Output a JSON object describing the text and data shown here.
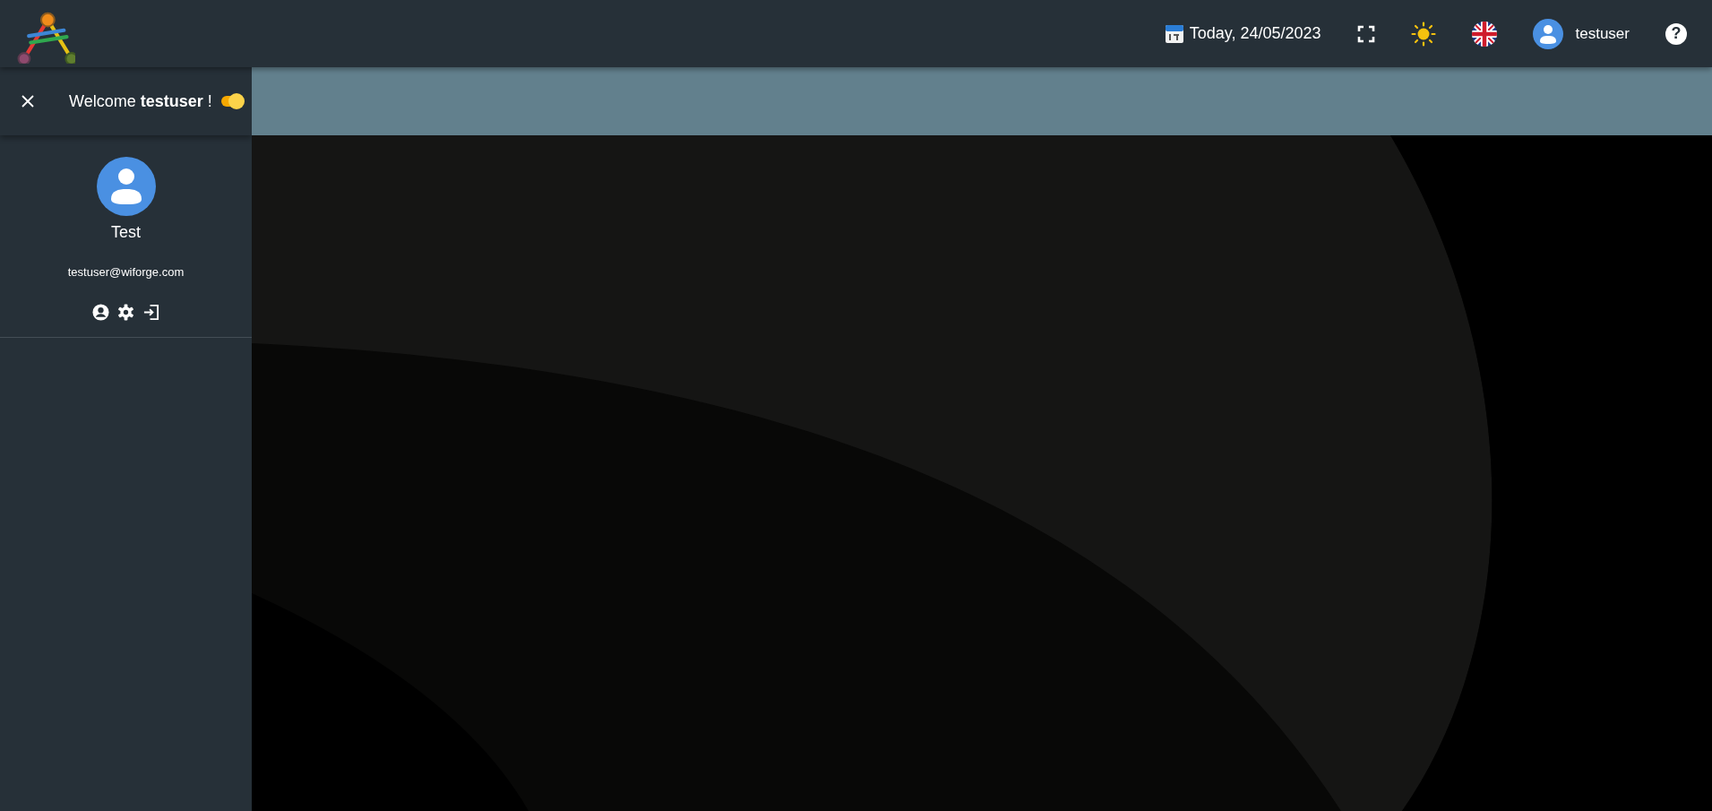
{
  "header": {
    "date": "Today, 24/05/2023",
    "username": "testuser",
    "help": "?"
  },
  "sidebar": {
    "welcome": "Welcome **testuser** !",
    "toggle": {
      "on": true
    },
    "profile_name": "Test",
    "email": "testuser@wiforge.com"
  }
}
